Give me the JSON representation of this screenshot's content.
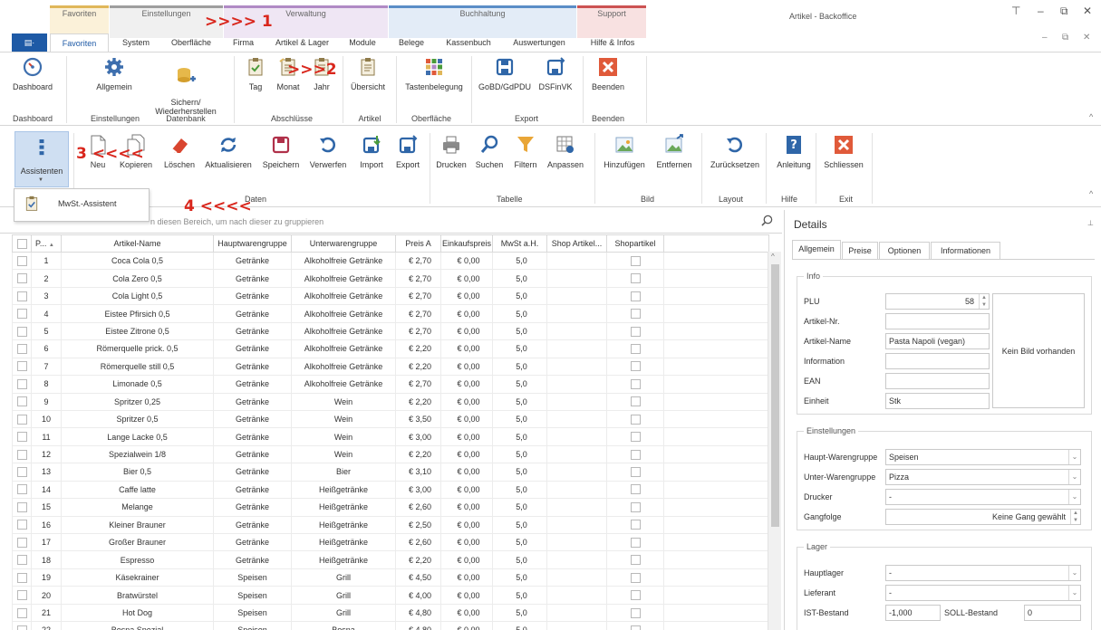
{
  "window": {
    "title": "Artikel - Backoffice",
    "controls": [
      "⊤",
      "–",
      "⧉",
      "✕"
    ],
    "sub_controls": [
      "–",
      "⧉",
      "✕"
    ]
  },
  "colors": {
    "favoriten": "#e0b75a",
    "einstellungen": "#9e9e9e",
    "verwaltung": "#b08ac5",
    "buchhaltung": "#5b8dc7",
    "support": "#cc5252",
    "accent": "#1e5aa6",
    "annotation": "#d9261c"
  },
  "groups": [
    "Favoriten",
    "Einstellungen",
    "Verwaltung",
    "Buchhaltung",
    "Support"
  ],
  "app_menu": "▤·",
  "tabs": [
    "Favoriten",
    "System",
    "Oberfläche",
    "Firma",
    "Artikel & Lager",
    "Module",
    "Belege",
    "Kassenbuch",
    "Auswertungen",
    "Hilfe & Infos"
  ],
  "ribbon": {
    "buttons": {
      "dashboard": "Dashboard",
      "allgemein": "Allgemein",
      "sichern": "Sichern/\nWiederherstellen",
      "tag": "Tag",
      "monat": "Monat",
      "jahr": "Jahr",
      "uebersicht": "Übersicht",
      "tastenbelegung": "Tastenbelegung",
      "gobd": "GoBD/GdPDU",
      "dsfinvk": "DSFinVK",
      "beenden": "Beenden"
    },
    "groups": {
      "dashboard": "Dashboard",
      "einstellungen": "Einstellungen",
      "datenbank": "Datenbank",
      "abschluesse": "Abschlüsse",
      "artikel": "Artikel",
      "oberflaeche": "Oberfläche",
      "export": "Export",
      "beenden": "Beenden"
    }
  },
  "toolbar": {
    "assistenten": "Assistenten",
    "buttons": [
      "Neu",
      "Kopieren",
      "Löschen",
      "Aktualisieren",
      "Speichern",
      "Verwerfen",
      "Import",
      "Export",
      "Drucken",
      "Suchen",
      "Filtern",
      "Anpassen",
      "Hinzufügen",
      "Entfernen",
      "Zurücksetzen",
      "Anleitung",
      "Schliessen"
    ],
    "groups": {
      "daten": "Daten",
      "tabelle": "Tabelle",
      "bild": "Bild",
      "layout": "Layout",
      "hilfe": "Hilfe",
      "exit": "Exit"
    }
  },
  "dropdown": {
    "item": "MwSt.-Assistent"
  },
  "annotations": [
    ">>>> 1",
    ">>>2",
    "3 <<<<",
    "4 <<<<"
  ],
  "grid": {
    "group_hint": "n diesen Bereich, um nach dieser zu gruppieren",
    "columns": [
      "P...",
      "Artikel-Name",
      "Hauptwarengruppe",
      "Unterwarengruppe",
      "Preis A",
      "Einkaufspreis",
      "MwSt a.H.",
      "Shop Artikel...",
      "Shopartikel"
    ],
    "rows": [
      [
        "1",
        "Coca Cola 0,5",
        "Getränke",
        "Alkoholfreie Getränke",
        "€ 2,70",
        "€ 0,00",
        "5,0"
      ],
      [
        "2",
        "Cola Zero 0,5",
        "Getränke",
        "Alkoholfreie Getränke",
        "€ 2,70",
        "€ 0,00",
        "5,0"
      ],
      [
        "3",
        "Cola Light 0,5",
        "Getränke",
        "Alkoholfreie Getränke",
        "€ 2,70",
        "€ 0,00",
        "5,0"
      ],
      [
        "4",
        "Eistee Pfirsich 0,5",
        "Getränke",
        "Alkoholfreie Getränke",
        "€ 2,70",
        "€ 0,00",
        "5,0"
      ],
      [
        "5",
        "Eistee Zitrone 0,5",
        "Getränke",
        "Alkoholfreie Getränke",
        "€ 2,70",
        "€ 0,00",
        "5,0"
      ],
      [
        "6",
        "Römerquelle prick. 0,5",
        "Getränke",
        "Alkoholfreie Getränke",
        "€ 2,20",
        "€ 0,00",
        "5,0"
      ],
      [
        "7",
        "Römerquelle still 0,5",
        "Getränke",
        "Alkoholfreie Getränke",
        "€ 2,20",
        "€ 0,00",
        "5,0"
      ],
      [
        "8",
        "Limonade 0,5",
        "Getränke",
        "Alkoholfreie Getränke",
        "€ 2,70",
        "€ 0,00",
        "5,0"
      ],
      [
        "9",
        "Spritzer 0,25",
        "Getränke",
        "Wein",
        "€ 2,20",
        "€ 0,00",
        "5,0"
      ],
      [
        "10",
        "Spritzer 0,5",
        "Getränke",
        "Wein",
        "€ 3,50",
        "€ 0,00",
        "5,0"
      ],
      [
        "11",
        "Lange Lacke 0,5",
        "Getränke",
        "Wein",
        "€ 3,00",
        "€ 0,00",
        "5,0"
      ],
      [
        "12",
        "Spezialwein 1/8",
        "Getränke",
        "Wein",
        "€ 2,20",
        "€ 0,00",
        "5,0"
      ],
      [
        "13",
        "Bier 0,5",
        "Getränke",
        "Bier",
        "€ 3,10",
        "€ 0,00",
        "5,0"
      ],
      [
        "14",
        "Caffe latte",
        "Getränke",
        "Heißgetränke",
        "€ 3,00",
        "€ 0,00",
        "5,0"
      ],
      [
        "15",
        "Melange",
        "Getränke",
        "Heißgetränke",
        "€ 2,60",
        "€ 0,00",
        "5,0"
      ],
      [
        "16",
        "Kleiner Brauner",
        "Getränke",
        "Heißgetränke",
        "€ 2,50",
        "€ 0,00",
        "5,0"
      ],
      [
        "17",
        "Großer Brauner",
        "Getränke",
        "Heißgetränke",
        "€ 2,60",
        "€ 0,00",
        "5,0"
      ],
      [
        "18",
        "Espresso",
        "Getränke",
        "Heißgetränke",
        "€ 2,20",
        "€ 0,00",
        "5,0"
      ],
      [
        "19",
        "Käsekrainer",
        "Speisen",
        "Grill",
        "€ 4,50",
        "€ 0,00",
        "5,0"
      ],
      [
        "20",
        "Bratwürstel",
        "Speisen",
        "Grill",
        "€ 4,00",
        "€ 0,00",
        "5,0"
      ],
      [
        "21",
        "Hot Dog",
        "Speisen",
        "Grill",
        "€ 4,80",
        "€ 0,00",
        "5,0"
      ],
      [
        "22",
        "Bosna Spezial",
        "Speisen",
        "Bosna",
        "€ 4,80",
        "€ 0,00",
        "5,0"
      ]
    ]
  },
  "details": {
    "title": "Details",
    "pin": "⊥",
    "tabs": [
      "Allgemein",
      "Preise",
      "Optionen",
      "Informationen"
    ],
    "info": {
      "legend": "Info",
      "plu_label": "PLU",
      "plu_value": "58",
      "artikelnr_label": "Artikel-Nr.",
      "artikelnr_value": "",
      "artikelname_label": "Artikel-Name",
      "artikelname_value": "Pasta Napoli (vegan)",
      "information_label": "Information",
      "information_value": "",
      "ean_label": "EAN",
      "ean_value": "",
      "einheit_label": "Einheit",
      "einheit_value": "Stk",
      "no_image": "Kein Bild vorhanden"
    },
    "einstellungen": {
      "legend": "Einstellungen",
      "haupt_label": "Haupt-Warengruppe",
      "haupt_value": "Speisen",
      "unter_label": "Unter-Warengruppe",
      "unter_value": "Pizza",
      "drucker_label": "Drucker",
      "drucker_value": "-",
      "gangfolge_label": "Gangfolge",
      "gangfolge_value": "Keine Gang gewählt"
    },
    "lager": {
      "legend": "Lager",
      "hauptlager_label": "Hauptlager",
      "hauptlager_value": "-",
      "lieferant_label": "Lieferant",
      "lieferant_value": "-",
      "ist_label": "IST-Bestand",
      "ist_value": "-1,000",
      "soll_label": "SOLL-Bestand",
      "soll_value": "0"
    }
  }
}
